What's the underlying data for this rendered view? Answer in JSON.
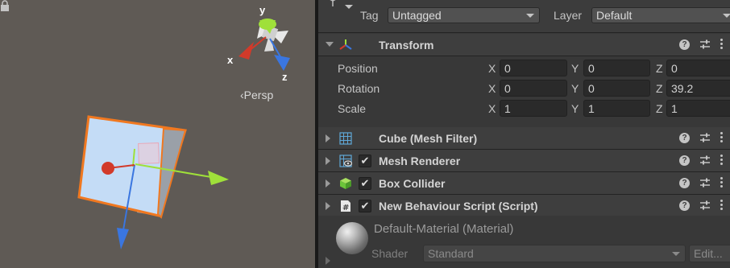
{
  "scene": {
    "gizmo": {
      "y_label": "y",
      "x_label": "x",
      "z_label": "z"
    },
    "persp_label": "‹Persp",
    "colors": {
      "x_axis": "#d23a2a",
      "y_axis": "#9fe03a",
      "z_axis": "#3a76e0",
      "selection": "#f07820",
      "cube_face": "#c4dcf6"
    }
  },
  "inspector": {
    "tag": {
      "label": "Tag",
      "value": "Untagged"
    },
    "layer": {
      "label": "Layer",
      "value": "Default"
    },
    "transform": {
      "title": "Transform",
      "position": {
        "label": "Position",
        "x": "0",
        "y": "0",
        "z": "0"
      },
      "rotation": {
        "label": "Rotation",
        "x": "0",
        "y": "0",
        "z": "39.2"
      },
      "scale": {
        "label": "Scale",
        "x": "1",
        "y": "1",
        "z": "1"
      },
      "axis_labels": {
        "x": "X",
        "y": "Y",
        "z": "Z"
      }
    },
    "components": [
      {
        "title": "Cube (Mesh Filter)",
        "icon": "mesh-filter-icon",
        "enabled": null
      },
      {
        "title": "Mesh Renderer",
        "icon": "mesh-renderer-icon",
        "enabled": true
      },
      {
        "title": "Box Collider",
        "icon": "box-collider-icon",
        "enabled": true
      },
      {
        "title": "New Behaviour Script (Script)",
        "icon": "script-icon",
        "enabled": true
      }
    ],
    "check_mark": "✔",
    "help_glyph": "?",
    "material": {
      "title": "Default-Material (Material)",
      "shader_label": "Shader",
      "shader_value": "Standard",
      "edit_label": "Edit..."
    }
  }
}
